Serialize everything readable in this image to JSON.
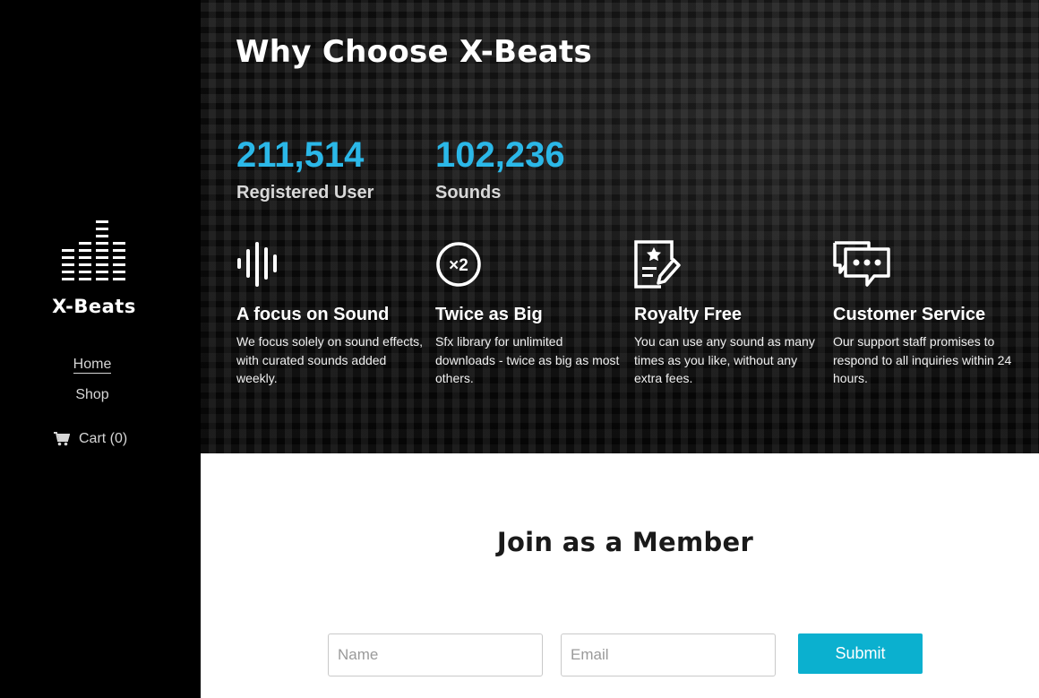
{
  "brand": {
    "name": "X-Beats",
    "logo_icon": "equalizer-bars-icon"
  },
  "nav": {
    "items": [
      {
        "label": "Home",
        "active": true
      },
      {
        "label": "Shop",
        "active": false
      }
    ],
    "cart": {
      "label": "Cart (0)",
      "icon": "cart-icon"
    }
  },
  "hero": {
    "title": "Why Choose X-Beats",
    "stats": [
      {
        "value": "211,514",
        "label": "Registered User"
      },
      {
        "value": "102,236",
        "label": "Sounds"
      }
    ],
    "features": [
      {
        "icon": "sound-wave-icon",
        "title": "A focus on Sound",
        "description": "We focus solely on sound effects, with curated sounds added weekly."
      },
      {
        "icon": "x2-circle-icon",
        "title": "Twice as Big",
        "description": "Sfx library for unlimited downloads - twice as big as most others."
      },
      {
        "icon": "certificate-pen-icon",
        "title": "Royalty Free",
        "description": "You can use any sound as many times as you like, without any extra fees."
      },
      {
        "icon": "chat-bubbles-icon",
        "title": "Customer Service",
        "description": "Our support staff promises to respond to all inquiries within 24 hours."
      }
    ],
    "accent_color": "#2bb8e8"
  },
  "join": {
    "title": "Join as a Member",
    "name_placeholder": "Name",
    "email_placeholder": "Email",
    "submit_label": "Submit",
    "button_color": "#0bb0cf"
  }
}
